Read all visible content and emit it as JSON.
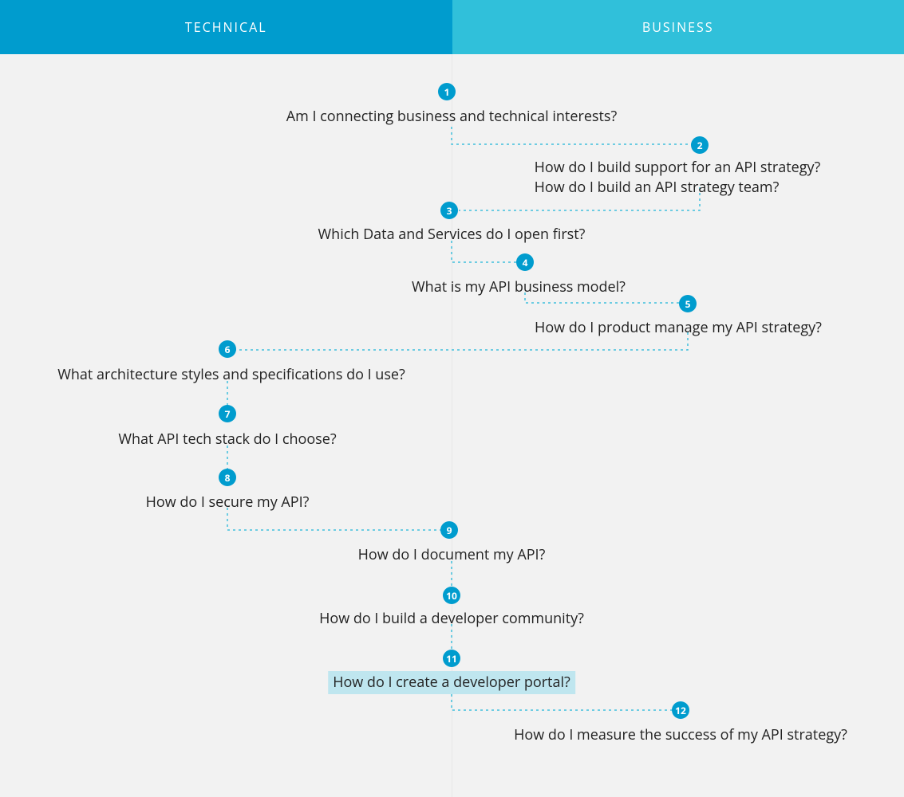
{
  "header": {
    "left_label": "TECHNICAL",
    "right_label": "BUSINESS"
  },
  "colors": {
    "header_left": "#009cce",
    "header_right": "#30c0da",
    "badge": "#009cce",
    "connector": "#41c0dc",
    "highlight": "#bfe6ef",
    "canvas_bg": "#f2f2f2"
  },
  "highlighted_node": 11,
  "nodes": [
    {
      "id": 1,
      "lines": [
        "Am I connecting business and technical interests?"
      ]
    },
    {
      "id": 2,
      "lines": [
        "How do I build support for an API strategy?",
        "How do I build an API strategy team?"
      ]
    },
    {
      "id": 3,
      "lines": [
        "Which Data and Services do I open first?"
      ]
    },
    {
      "id": 4,
      "lines": [
        "What is my API business model?"
      ]
    },
    {
      "id": 5,
      "lines": [
        "How do I product manage my API strategy?"
      ]
    },
    {
      "id": 6,
      "lines": [
        "What architecture styles and specifications do I use?"
      ]
    },
    {
      "id": 7,
      "lines": [
        "What API tech stack do I choose?"
      ]
    },
    {
      "id": 8,
      "lines": [
        "How do I secure my API?"
      ]
    },
    {
      "id": 9,
      "lines": [
        "How do I document my API?"
      ]
    },
    {
      "id": 10,
      "lines": [
        "How do I build a developer community?"
      ]
    },
    {
      "id": 11,
      "lines": [
        "How do I create a developer portal?"
      ]
    },
    {
      "id": 12,
      "lines": [
        "How do I measure the success of my API strategy?"
      ]
    }
  ]
}
